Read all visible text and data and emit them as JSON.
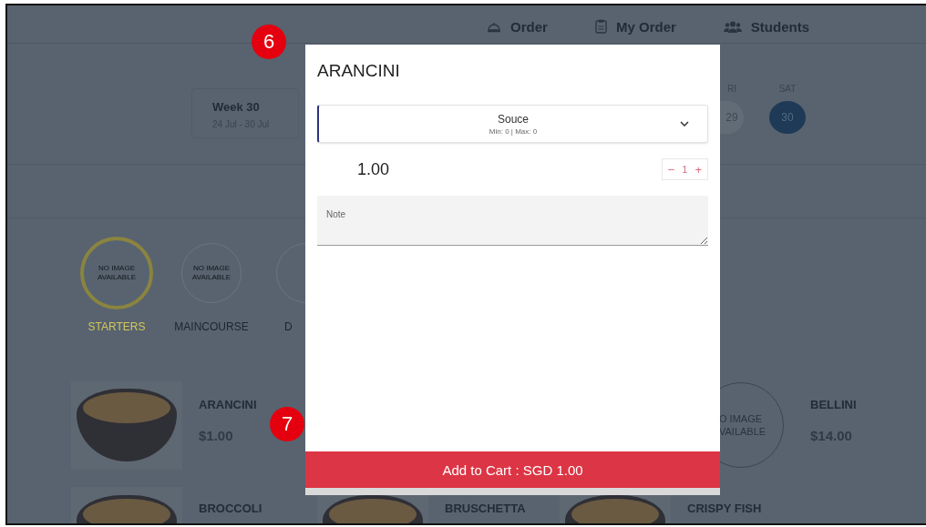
{
  "nav": [
    {
      "label": "Order"
    },
    {
      "label": "My Order"
    },
    {
      "label": "Students"
    }
  ],
  "week": {
    "title": "Week 30",
    "range": "24 Jul - 30 Jul"
  },
  "days": [
    {
      "label": "RI",
      "date": "29",
      "selected": false
    },
    {
      "label": "SAT",
      "date": "30",
      "selected": true
    }
  ],
  "categories": [
    {
      "image_text": "NO IMAGE AVAILABLE",
      "label": "STARTERS",
      "selected": true
    },
    {
      "image_text": "NO IMAGE AVAILABLE",
      "label": "MAINCOURSE",
      "selected": false
    },
    {
      "label": "D",
      "selected": false
    }
  ],
  "featured_row": [
    {
      "name": "ARANCINI",
      "price": "$1.00",
      "kind": "photo"
    },
    {
      "name": "BELLINI",
      "price": "$14.00",
      "kind": "placeholder",
      "image_text": "O IMAGE VAILABLE"
    }
  ],
  "bottom_row": [
    {
      "name": "BROCCOLI"
    },
    {
      "name": "BRUSCHETTA"
    },
    {
      "name": "CRISPY FISH"
    }
  ],
  "modal": {
    "title": "ARANCINI",
    "option": {
      "label": "Souce",
      "hint": "Min: 0 | Max: 0"
    },
    "price": "1.00",
    "quantity": {
      "minus": "−",
      "value": "1",
      "plus": "+"
    },
    "note_placeholder": "Note",
    "button": "Add to Cart : SGD 1.00"
  },
  "callouts": [
    "6",
    "7"
  ]
}
